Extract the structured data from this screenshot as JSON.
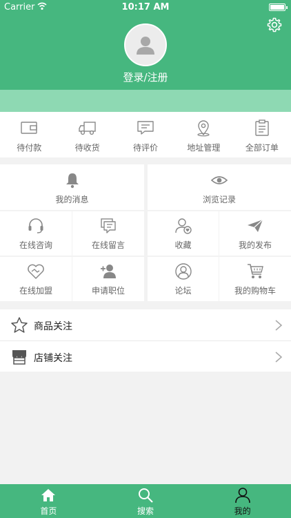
{
  "status_bar": {
    "carrier": "Carrier",
    "time": "10:17 AM"
  },
  "header": {
    "login_label": "登录/注册"
  },
  "orders": [
    {
      "label": "待付款",
      "icon": "wallet-icon"
    },
    {
      "label": "待收货",
      "icon": "truck-icon"
    },
    {
      "label": "待评价",
      "icon": "comment-icon"
    },
    {
      "label": "地址管理",
      "icon": "location-pin-icon"
    },
    {
      "label": "全部订单",
      "icon": "clipboard-icon"
    }
  ],
  "grid": {
    "messages": "我的消息",
    "history": "浏览记录",
    "consult": "在线咨询",
    "leave_message": "在线留言",
    "favorites": "收藏",
    "my_posts": "我的发布",
    "join": "在线加盟",
    "apply_job": "申请职位",
    "forum": "论坛",
    "cart": "我的购物车"
  },
  "list": [
    {
      "label": "商品关注",
      "icon": "star-icon"
    },
    {
      "label": "店铺关注",
      "icon": "store-icon"
    }
  ],
  "tabbar": [
    {
      "label": "首页",
      "icon": "home-icon"
    },
    {
      "label": "搜索",
      "icon": "search-icon"
    },
    {
      "label": "我的",
      "icon": "person-icon",
      "active": true
    }
  ],
  "colors": {
    "primary": "#46b77f",
    "band": "#8ed9b3",
    "icon_gray": "#888888"
  }
}
